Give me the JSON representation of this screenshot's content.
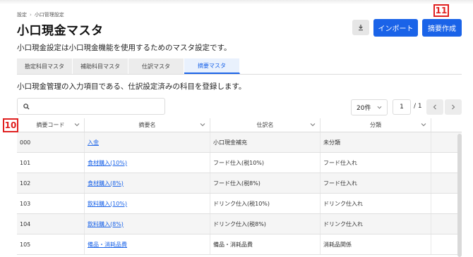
{
  "breadcrumb": [
    "設定",
    "小口管理設定"
  ],
  "breadcrumb_sep": "›",
  "page_title": "小口現金マスタ",
  "header": {
    "download_icon": "download-icon",
    "import_label": "インポート",
    "create_label": "摘要作成"
  },
  "markers": {
    "m11": "11",
    "m10": "10"
  },
  "description": "小口現金設定は小口現金機能を使用するためのマスタ設定です。",
  "tabs": [
    {
      "label": "勘定科目マスタ",
      "active": false
    },
    {
      "label": "補助科目マスタ",
      "active": false
    },
    {
      "label": "仕訳マスタ",
      "active": false
    },
    {
      "label": "摘要マスタ",
      "active": true
    }
  ],
  "sub_description": "小口現金管理の入力項目である、仕訳設定済みの科目を登録します。",
  "search": {
    "placeholder": "",
    "value": ""
  },
  "pagination": {
    "per_page": "20件",
    "current": "1",
    "total": "/ 1"
  },
  "table": {
    "headers": [
      "摘要コード",
      "摘要名",
      "仕訳名",
      "分類"
    ],
    "rows": [
      {
        "code": "000",
        "name": "入金",
        "journal": "小口現金補充",
        "category": "未分類"
      },
      {
        "code": "101",
        "name": "食材購入(10%)",
        "journal": "フード仕入(税10%)",
        "category": "フード仕入れ"
      },
      {
        "code": "102",
        "name": "食材購入(8%)",
        "journal": "フード仕入(税8%)",
        "category": "フード仕入れ"
      },
      {
        "code": "103",
        "name": "飲料購入(10%)",
        "journal": "ドリンク仕入(税10%)",
        "category": "ドリンク仕入れ"
      },
      {
        "code": "104",
        "name": "飲料購入(8%)",
        "journal": "ドリンク仕入(税8%)",
        "category": "ドリンク仕入れ"
      },
      {
        "code": "105",
        "name": "備品・消耗品費",
        "journal": "備品・消耗品費",
        "category": "消耗品関係"
      }
    ]
  },
  "colors": {
    "accent": "#1a63e8",
    "marker": "#e02020"
  }
}
